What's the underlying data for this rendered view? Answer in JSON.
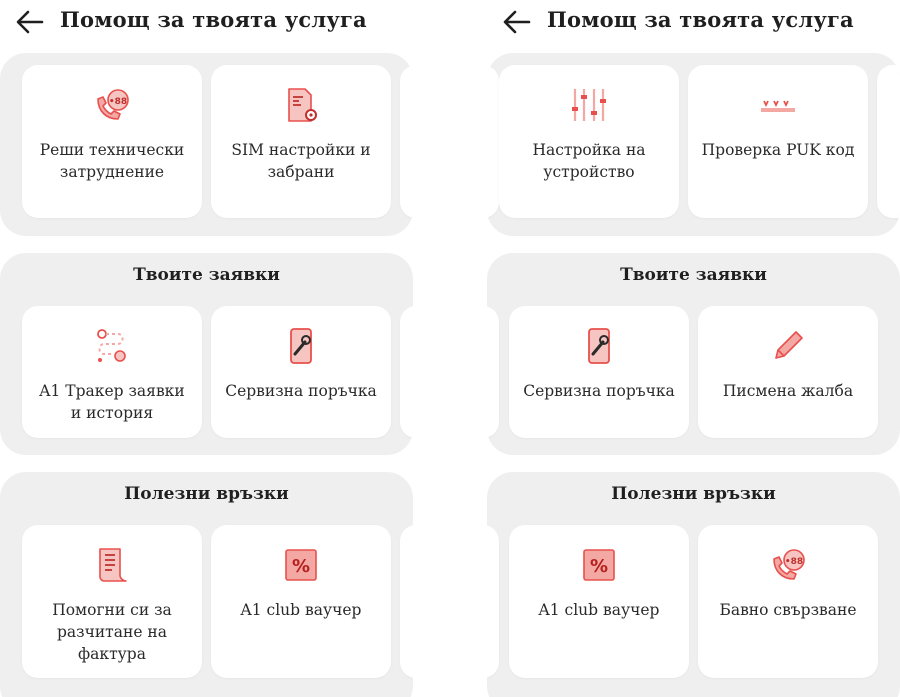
{
  "colors": {
    "accent": "#e8504d",
    "accent_light": "#f3a8a4",
    "section_bg": "#efefef"
  },
  "left": {
    "header": {
      "title": "Помощ за твоята услуга",
      "back_icon": "arrow-left-icon"
    },
    "top_cards": [
      {
        "label": "Реши технически затруднение",
        "icon": "phone-support-icon"
      },
      {
        "label": "SIM настройки и забрани",
        "icon": "sim-settings-icon"
      }
    ],
    "requests": {
      "title": "Твоите заявки",
      "cards": [
        {
          "label": "A1 Тракер заявки и история",
          "icon": "route-tracker-icon"
        },
        {
          "label": "Сервизна поръчка",
          "icon": "phone-repair-icon"
        }
      ]
    },
    "links": {
      "title": "Полезни връзки",
      "cards": [
        {
          "label": "Помогни си за разчитане на фактура",
          "icon": "invoice-icon"
        },
        {
          "label": "A1 club ваучер",
          "icon": "percent-voucher-icon"
        }
      ]
    }
  },
  "right": {
    "header": {
      "title": "Помощ за твоята услуга",
      "back_icon": "arrow-left-icon"
    },
    "top_cards": [
      {
        "label": "Настройка на устройство",
        "icon": "sliders-icon"
      },
      {
        "label": "Проверка PUK код",
        "icon": "puk-code-icon"
      }
    ],
    "requests": {
      "title": "Твоите заявки",
      "cards": [
        {
          "label": "Сервизна поръчка",
          "icon": "phone-repair-icon"
        },
        {
          "label": "Писмена жалба",
          "icon": "pencil-icon"
        }
      ]
    },
    "links": {
      "title": "Полезни връзки",
      "cards": [
        {
          "label": "A1 club ваучер",
          "icon": "percent-voucher-icon"
        },
        {
          "label": "Бавно свързване",
          "icon": "phone-support-icon"
        }
      ]
    }
  }
}
